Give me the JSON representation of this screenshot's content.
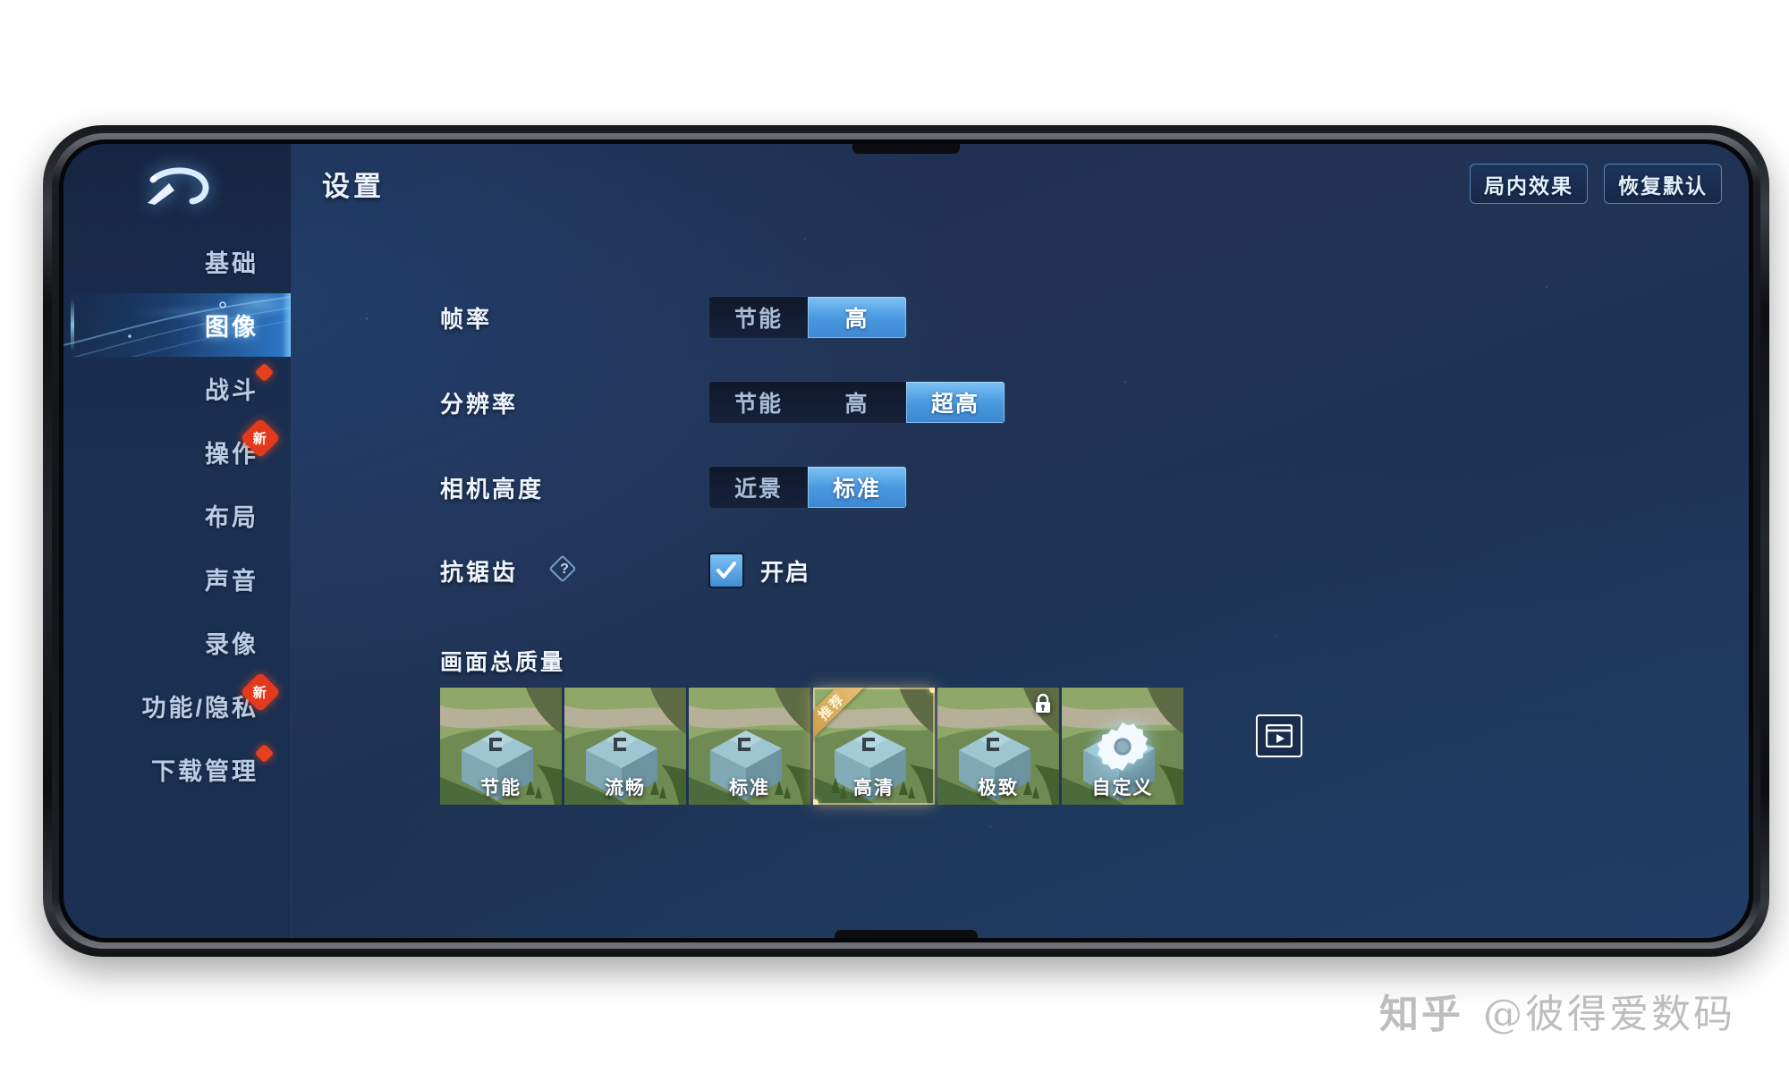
{
  "sidebar": {
    "back_icon": "back-arrow-icon",
    "items": [
      {
        "label": "基础",
        "active": false,
        "badge": "none"
      },
      {
        "label": "图像",
        "active": true,
        "badge": "none"
      },
      {
        "label": "战斗",
        "active": false,
        "badge": "dot"
      },
      {
        "label": "操作",
        "active": false,
        "badge": "new",
        "badge_text": "新"
      },
      {
        "label": "布局",
        "active": false,
        "badge": "none"
      },
      {
        "label": "声音",
        "active": false,
        "badge": "none"
      },
      {
        "label": "录像",
        "active": false,
        "badge": "none"
      },
      {
        "label": "功能/隐私",
        "active": false,
        "badge": "new",
        "badge_text": "新"
      },
      {
        "label": "下载管理",
        "active": false,
        "badge": "dot"
      }
    ]
  },
  "header": {
    "title": "设置",
    "buttons": [
      {
        "label": "局内效果"
      },
      {
        "label": "恢复默认"
      }
    ]
  },
  "settings": {
    "frame_rate": {
      "label": "帧率",
      "options": [
        "节能",
        "高"
      ],
      "selected": "高"
    },
    "resolution": {
      "label": "分辨率",
      "options": [
        "节能",
        "高",
        "超高"
      ],
      "selected": "超高"
    },
    "camera_height": {
      "label": "相机高度",
      "options": [
        "近景",
        "标准"
      ],
      "selected": "标准"
    },
    "anti_aliasing": {
      "label": "抗锯齿",
      "help_icon": "question-diamond-icon",
      "checkbox_label": "开启",
      "checked": true
    }
  },
  "quality": {
    "heading": "画面总质量",
    "tiles": [
      {
        "label": "节能",
        "selected": false,
        "locked": false,
        "ribbon": "",
        "icon": ""
      },
      {
        "label": "流畅",
        "selected": false,
        "locked": false,
        "ribbon": "",
        "icon": ""
      },
      {
        "label": "标准",
        "selected": false,
        "locked": false,
        "ribbon": "",
        "icon": ""
      },
      {
        "label": "高清",
        "selected": true,
        "locked": false,
        "ribbon": "推荐",
        "icon": ""
      },
      {
        "label": "极致",
        "selected": false,
        "locked": true,
        "ribbon": "",
        "icon": "lock-icon"
      },
      {
        "label": "自定义",
        "selected": false,
        "locked": false,
        "ribbon": "",
        "icon": "gear-icon"
      }
    ],
    "preview_button_icon": "video-preview-icon"
  },
  "watermark": {
    "logo": "知乎",
    "handle": "@彼得爱数码"
  },
  "colors": {
    "accent_blue": "#4a9ae0",
    "accent_light": "#7ec2f5",
    "badge_red": "#e33a1d",
    "selected_gold": "#e8c98a",
    "panel_bg": "#1d3354"
  }
}
